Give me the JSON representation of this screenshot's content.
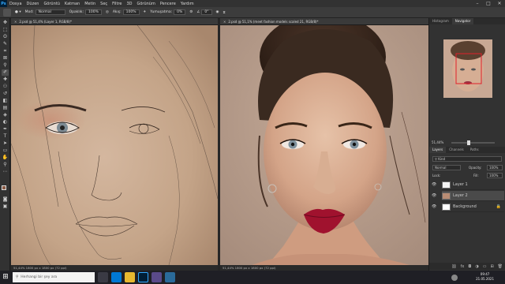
{
  "menubar": {
    "logo": "Ps",
    "items": [
      "Dosya",
      "Düzen",
      "Görüntü",
      "Katman",
      "Metin",
      "Seç",
      "Filtre",
      "3D",
      "Görünüm",
      "Pencere",
      "Yardım"
    ]
  },
  "options": {
    "mode_label": "Mod:",
    "mode_value": "Normal",
    "opacity_label": "Opaklık:",
    "opacity_value": "100%",
    "flow_label": "Akış:",
    "flow_value": "100%",
    "smoothing_label": "Yumuşatma:",
    "smoothing_value": "0%",
    "angle_value": "0°"
  },
  "documents": [
    {
      "tab_title": "2.psd @ 51,4% (Layer 1, RGB/8)*",
      "status": "51,44%   1800 px x 1800 px (72 ppi)"
    },
    {
      "tab_title": "2.psd @ 51,1% (meet fashion models scaled 21, RGB/8)*",
      "status": "51,44%   1800 px x 1800 px (72 ppi)"
    }
  ],
  "panels": {
    "top_tabs": [
      "Histogram",
      "Navigator"
    ],
    "zoom_value": "51,44%",
    "layer_tabs": [
      "Layers",
      "Channels",
      "Paths"
    ],
    "kind_label": "Kind",
    "blend_mode": "Normal",
    "opacity_label": "Opacity:",
    "opacity_value": "100%",
    "lock_label": "Lock:",
    "fill_label": "Fill:",
    "fill_value": "100%",
    "layers": [
      {
        "name": "Layer 1",
        "visible": true,
        "selected": false
      },
      {
        "name": "Layer 2",
        "visible": true,
        "selected": true
      },
      {
        "name": "Background",
        "visible": true,
        "selected": false
      }
    ]
  },
  "taskbar": {
    "search_placeholder": "Herhangi bir şey ara",
    "time": "09:47",
    "date": "21.05.2021"
  },
  "colors": {
    "accent": "#31a8ff",
    "selection": "#4a4a4a",
    "lip_red": "#a0122e"
  }
}
